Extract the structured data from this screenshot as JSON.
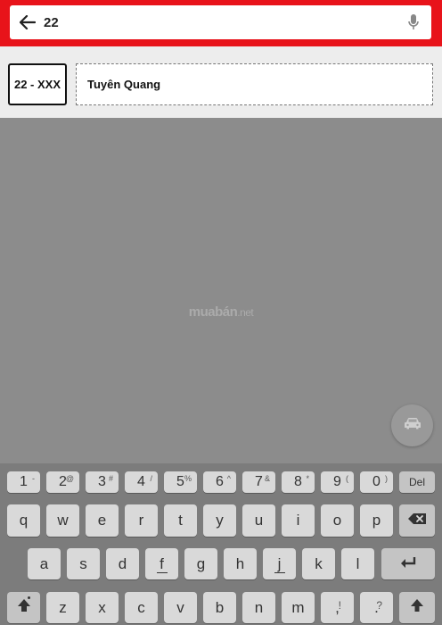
{
  "search": {
    "value": "22"
  },
  "result": {
    "plate": "22 - XXX",
    "province": "Tuyên Quang"
  },
  "watermark": {
    "brand": "muabán",
    "tld": ".net"
  },
  "fab": {
    "icon": "car-icon"
  },
  "keyboard": {
    "number_row": [
      {
        "main": "1",
        "sup": "-"
      },
      {
        "main": "2",
        "sup": "@"
      },
      {
        "main": "3",
        "sup": "#"
      },
      {
        "main": "4",
        "sup": "/"
      },
      {
        "main": "5",
        "sup": "%"
      },
      {
        "main": "6",
        "sup": "^"
      },
      {
        "main": "7",
        "sup": "&"
      },
      {
        "main": "8",
        "sup": "*"
      },
      {
        "main": "9",
        "sup": "("
      },
      {
        "main": "0",
        "sup": ")"
      }
    ],
    "del_label": "Del",
    "row1": [
      "q",
      "w",
      "e",
      "r",
      "t",
      "y",
      "u",
      "i",
      "o",
      "p"
    ],
    "row2": [
      "a",
      "s",
      "d",
      "f",
      "g",
      "h",
      "j",
      "k",
      "l"
    ],
    "row3": [
      "z",
      "x",
      "c",
      "v",
      "b",
      "n",
      "m"
    ],
    "punct1": {
      "main": ",",
      "sup": "!"
    },
    "punct2": {
      "main": ".",
      "sup": "?"
    }
  },
  "icons": {
    "back": "arrow-left-icon",
    "mic": "microphone-icon",
    "backspace": "backspace-icon",
    "enter": "enter-icon",
    "shift": "shift-icon",
    "go": "arrow-up-icon"
  }
}
